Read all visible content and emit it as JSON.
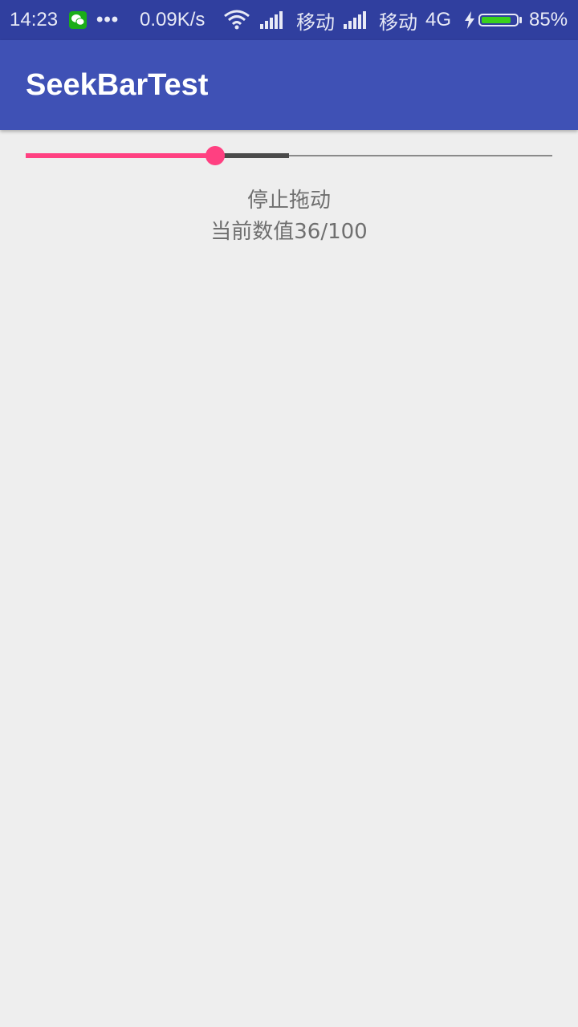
{
  "status_bar": {
    "time": "14:23",
    "network_speed": "0.09K/s",
    "carrier_1": "移动",
    "carrier_2": "移动",
    "network_type": "4G",
    "battery_percent": "85%",
    "battery_level": 0.85,
    "icons": [
      "wechat-icon",
      "more-dots-icon",
      "wifi-icon",
      "signal-icon",
      "signal-icon",
      "charging-icon",
      "battery-icon"
    ]
  },
  "app_bar": {
    "title": "SeekBarTest",
    "color": "#3f51b5"
  },
  "seekbar": {
    "progress": 36,
    "secondary_progress": 50,
    "max": 100,
    "accent_color": "#ff4081"
  },
  "status": {
    "drag_state": "停止拖动",
    "current_value": "当前数值36/100"
  }
}
